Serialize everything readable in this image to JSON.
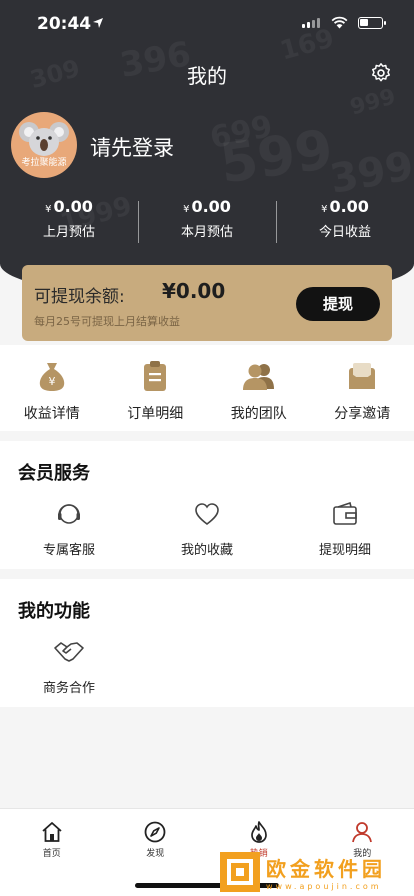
{
  "status": {
    "time": "20:44"
  },
  "header": {
    "title": "我的"
  },
  "profile": {
    "avatar_tag": "考拉聚能源",
    "login_prompt": "请先登录"
  },
  "stats": [
    {
      "currency": "¥",
      "amount": "0.00",
      "label": "上月预估"
    },
    {
      "currency": "¥",
      "amount": "0.00",
      "label": "本月预估"
    },
    {
      "currency": "¥",
      "amount": "0.00",
      "label": "今日收益"
    }
  ],
  "balance": {
    "label": "可提现余额:",
    "amount": "¥0.00",
    "note": "每月25号可提现上月结算收益",
    "button": "提现"
  },
  "quick_actions": [
    {
      "label": "收益详情",
      "icon": "money-bag-icon"
    },
    {
      "label": "订单明细",
      "icon": "clipboard-icon"
    },
    {
      "label": "我的团队",
      "icon": "team-icon"
    },
    {
      "label": "分享邀请",
      "icon": "invite-envelope-icon"
    }
  ],
  "member_services": {
    "title": "会员服务",
    "items": [
      {
        "label": "专属客服",
        "icon": "headset-icon"
      },
      {
        "label": "我的收藏",
        "icon": "heart-icon"
      },
      {
        "label": "提现明细",
        "icon": "wallet-icon"
      }
    ]
  },
  "my_functions": {
    "title": "我的功能",
    "items": [
      {
        "label": "商务合作",
        "icon": "handshake-icon"
      }
    ]
  },
  "tabbar": [
    {
      "label": "首页",
      "icon": "home-icon"
    },
    {
      "label": "发现",
      "icon": "compass-icon"
    },
    {
      "label": "热销",
      "icon": "flame-icon"
    },
    {
      "label": "我的",
      "icon": "user-icon"
    }
  ],
  "watermark": {
    "text": "欧金软件园",
    "url": "www.apoujin.com"
  },
  "colors": {
    "header_bg": "#2f3035",
    "gold": "#c8ab7e",
    "icon_gold": "#b59564",
    "hot_red": "#c0392b",
    "watermark": "#f2a01f"
  }
}
